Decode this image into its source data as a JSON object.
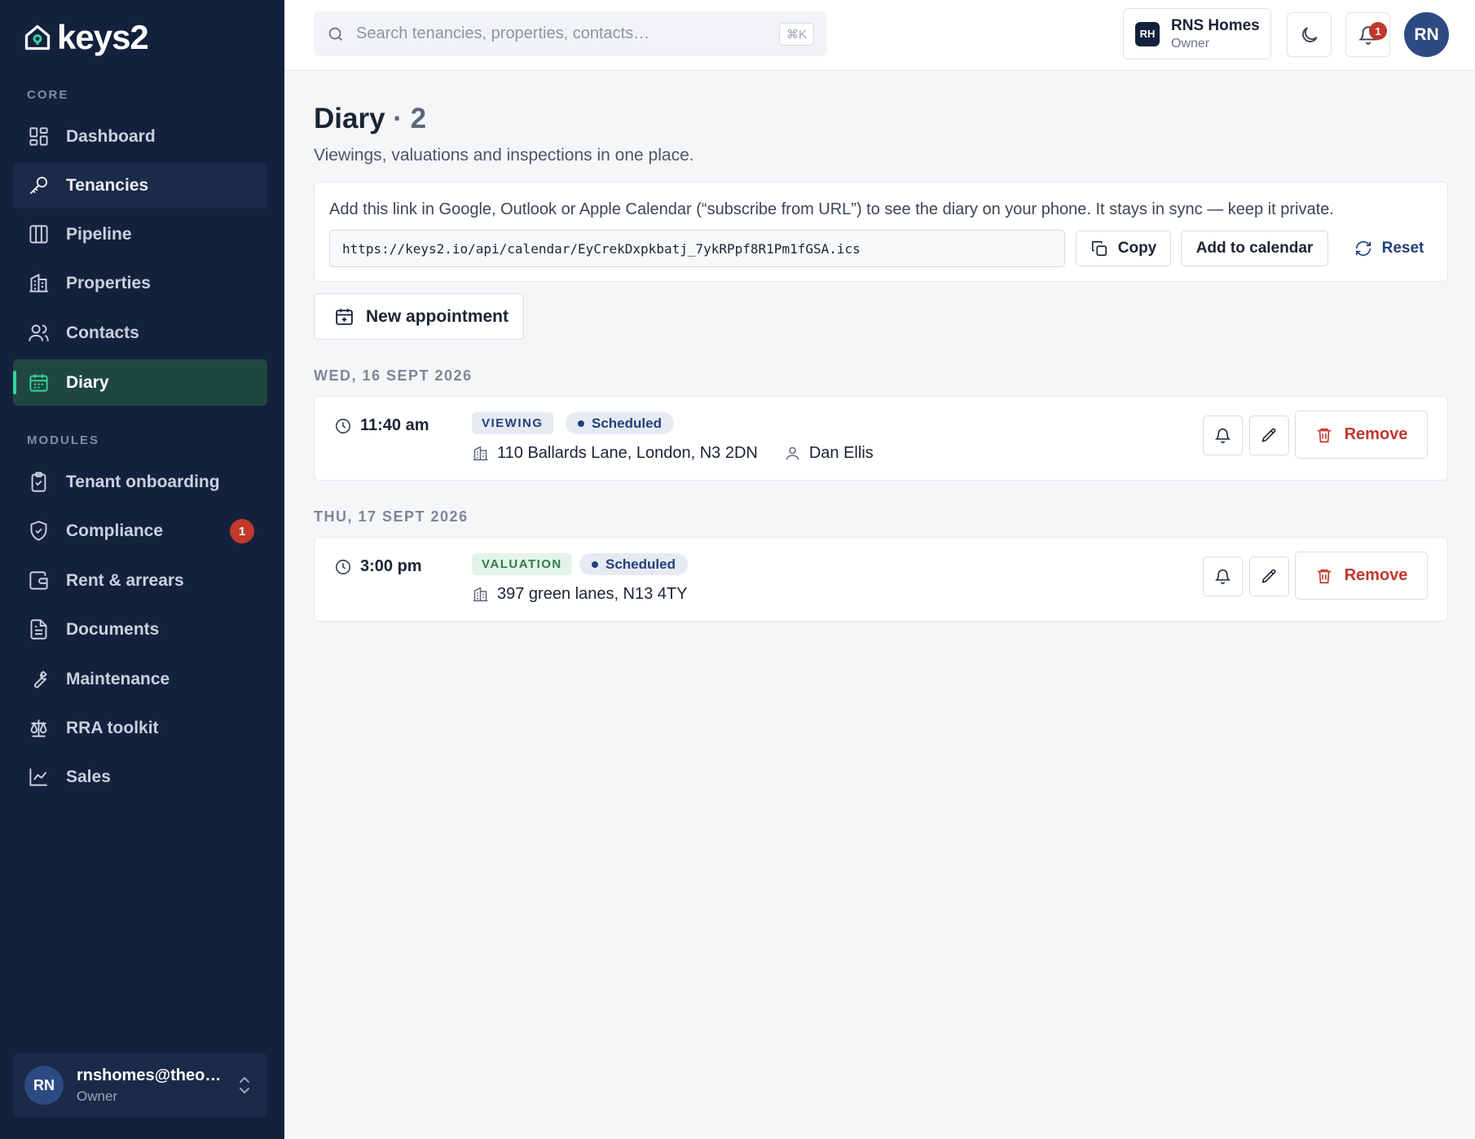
{
  "app": {
    "name": "keys2"
  },
  "sidebar": {
    "sections": {
      "core": "CORE",
      "modules": "MODULES"
    },
    "core_items": [
      {
        "label": "Dashboard",
        "icon": "dashboard-icon"
      },
      {
        "label": "Tenancies",
        "icon": "key-icon",
        "state": "hover"
      },
      {
        "label": "Pipeline",
        "icon": "kanban-icon"
      },
      {
        "label": "Properties",
        "icon": "building-icon"
      },
      {
        "label": "Contacts",
        "icon": "users-icon"
      },
      {
        "label": "Diary",
        "icon": "calendar-icon",
        "state": "active"
      }
    ],
    "module_items": [
      {
        "label": "Tenant onboarding",
        "icon": "clipboard-check-icon"
      },
      {
        "label": "Compliance",
        "icon": "shield-check-icon",
        "badge": "1"
      },
      {
        "label": "Rent & arrears",
        "icon": "wallet-icon"
      },
      {
        "label": "Documents",
        "icon": "document-icon"
      },
      {
        "label": "Maintenance",
        "icon": "wrench-icon"
      },
      {
        "label": "RRA toolkit",
        "icon": "scale-icon"
      },
      {
        "label": "Sales",
        "icon": "chart-line-icon"
      }
    ],
    "user": {
      "initials": "RN",
      "email": "rnshomes@theoli…",
      "role": "Owner"
    }
  },
  "topbar": {
    "search_placeholder": "Search tenancies, properties, contacts…",
    "search_shortcut": "⌘K",
    "org": {
      "initials": "RH",
      "name": "RNS Homes",
      "role": "Owner"
    },
    "notifications_count": "1",
    "avatar_initials": "RN"
  },
  "page": {
    "title": "Diary",
    "count": "· 2",
    "subtitle": "Viewings, valuations and inspections in one place."
  },
  "calendar_sync": {
    "description": "Add this link in Google, Outlook or Apple Calendar (“subscribe from URL”) to see the diary on your phone. It stays in sync — keep it private.",
    "url": "https://keys2.io/api/calendar/EyCrekDxpkbatj_7ykRPpf8R1Pm1fGSA.ics",
    "copy_label": "Copy",
    "add_label": "Add to calendar",
    "reset_label": "Reset"
  },
  "new_appointment_label": "New appointment",
  "days": [
    {
      "date": "WED, 16 SEPT 2026",
      "appointments": [
        {
          "time": "11:40 am",
          "type": "VIEWING",
          "status": "Scheduled",
          "address": "110 Ballards Lane, London, N3 2DN",
          "contact": "Dan Ellis",
          "remove_label": "Remove"
        }
      ]
    },
    {
      "date": "THU, 17 SEPT 2026",
      "appointments": [
        {
          "time": "3:00 pm",
          "type": "VALUATION",
          "status": "Scheduled",
          "address": "397 green lanes, N13 4TY",
          "remove_label": "Remove"
        }
      ]
    }
  ],
  "colors": {
    "sidebar_bg": "#14213d",
    "accent_green": "#34d399",
    "danger": "#c0392b",
    "primary": "#23407a"
  }
}
